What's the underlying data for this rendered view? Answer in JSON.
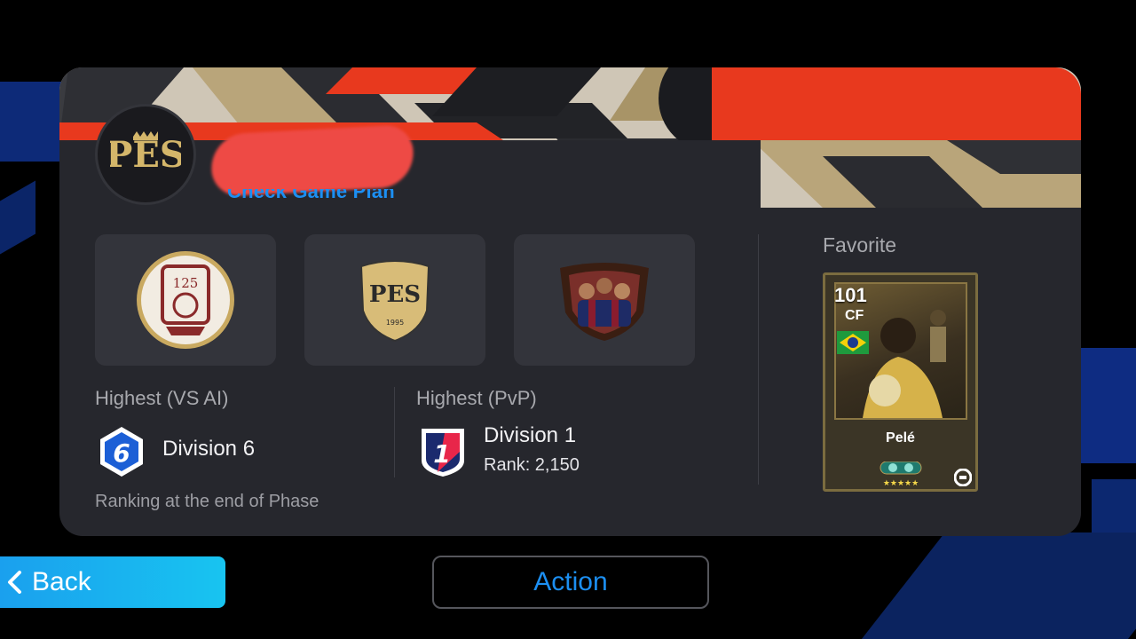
{
  "profile": {
    "link_text": "Check Game Plan",
    "emblem_icon": "pes-emblem-icon"
  },
  "badges": [
    {
      "name": "bayern-125-badge-icon"
    },
    {
      "name": "pes-1995-shield-icon"
    },
    {
      "name": "barcelona-trio-badge-icon"
    }
  ],
  "highest_ai": {
    "label": "Highest (VS AI)",
    "division_number": "6",
    "division": "Division 6",
    "note": "Ranking at the end of Phase"
  },
  "highest_pvp": {
    "label": "Highest (PvP)",
    "division_number": "1",
    "division": "Division 1",
    "rank": "Rank: 2,150"
  },
  "favorite": {
    "label": "Favorite",
    "rating": "101",
    "position": "CF",
    "name": "Pelé",
    "flag": "brazil-flag-icon"
  },
  "footer": {
    "back_label": "Back",
    "action_label": "Action"
  },
  "colors": {
    "accent_blue": "#1c8ff2",
    "banner_red": "#e8391e",
    "banner_gold": "#b9a57a",
    "card_bg": "#26272d"
  }
}
